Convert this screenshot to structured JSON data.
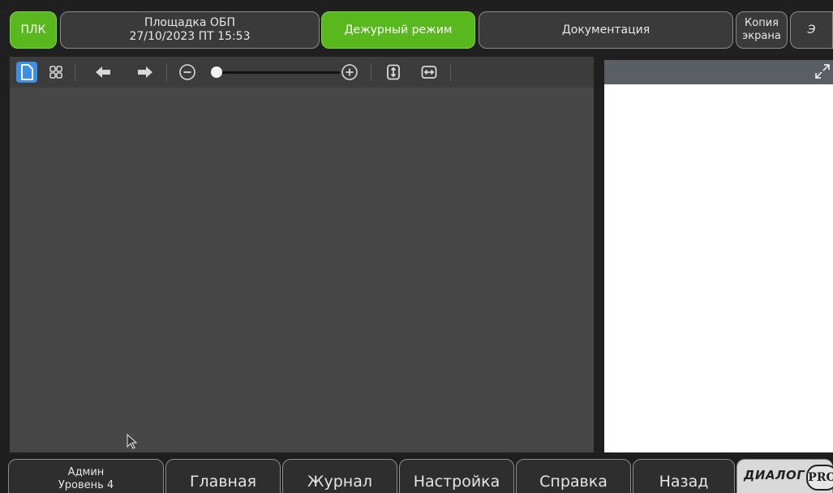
{
  "topbar": {
    "plc_label": "ПЛК",
    "site_name": "Площадка ОБП",
    "datetime": "27/10/2023 ПТ 15:53",
    "mode_label": "Дежурный режим",
    "docs_label": "Документация",
    "screenshot_label_line1": "Копия",
    "screenshot_label_line2": "экрана",
    "extra_label": "Э"
  },
  "toolbar": {
    "icons": [
      "single-page-icon",
      "grid-view-icon",
      "arrow-left-icon",
      "arrow-right-icon",
      "zoom-out-icon",
      "zoom-in-icon",
      "fit-height-icon",
      "fit-width-icon"
    ],
    "zoom_level": 0.0
  },
  "bottombar": {
    "user_name": "Админ",
    "user_level": "Уровень 4",
    "home_label": "Главная",
    "journal_label": "Журнал",
    "settings_label": "Настройка",
    "help_label": "Справка",
    "back_label": "Назад",
    "brand_word": "ДИАЛОГ",
    "brand_pro": "PRO"
  },
  "colors": {
    "accent_green": "#58b81e",
    "active_blue": "#3d8ee6"
  }
}
